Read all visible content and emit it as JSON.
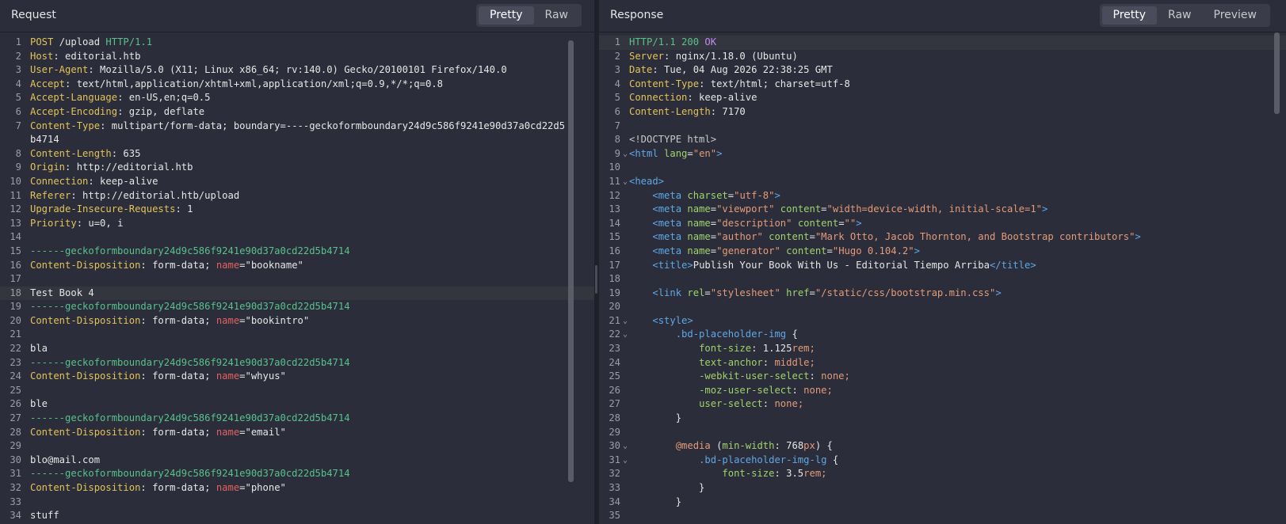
{
  "request": {
    "title": "Request",
    "tabs": [
      "Pretty",
      "Raw"
    ],
    "active_tab": "Pretty",
    "lines": [
      {
        "n": "1",
        "segs": [
          [
            "m",
            "POST"
          ],
          [
            "str",
            " /upload "
          ],
          [
            "v",
            "HTTP/1.1"
          ]
        ]
      },
      {
        "n": "2",
        "segs": [
          [
            "k",
            "Host"
          ],
          [
            "str",
            ": editorial.htb"
          ]
        ]
      },
      {
        "n": "3",
        "segs": [
          [
            "k",
            "User-Agent"
          ],
          [
            "str",
            ": Mozilla/5.0 (X11; Linux x86_64; rv:140.0) Gecko/20100101 Firefox/140.0"
          ]
        ]
      },
      {
        "n": "4",
        "segs": [
          [
            "k",
            "Accept"
          ],
          [
            "str",
            ": text/html,application/xhtml+xml,application/xml;q=0.9,*/*;q=0.8"
          ]
        ]
      },
      {
        "n": "5",
        "segs": [
          [
            "k",
            "Accept-Language"
          ],
          [
            "str",
            ": en-US,en;q=0.5"
          ]
        ]
      },
      {
        "n": "6",
        "segs": [
          [
            "k",
            "Accept-Encoding"
          ],
          [
            "str",
            ": gzip, deflate"
          ]
        ]
      },
      {
        "n": "7",
        "segs": [
          [
            "k",
            "Content-Type"
          ],
          [
            "str",
            ": multipart/form-data; boundary=----geckoformboundary24d9c586f9241e90d37a0cd22d5"
          ]
        ]
      },
      {
        "n": "",
        "segs": [
          [
            "str",
            "b4714"
          ]
        ]
      },
      {
        "n": "8",
        "segs": [
          [
            "k",
            "Content-Length"
          ],
          [
            "str",
            ": 635"
          ]
        ]
      },
      {
        "n": "9",
        "segs": [
          [
            "k",
            "Origin"
          ],
          [
            "str",
            ": http://editorial.htb"
          ]
        ]
      },
      {
        "n": "10",
        "segs": [
          [
            "k",
            "Connection"
          ],
          [
            "str",
            ": keep-alive"
          ]
        ]
      },
      {
        "n": "11",
        "segs": [
          [
            "k",
            "Referer"
          ],
          [
            "str",
            ": http://editorial.htb/upload"
          ]
        ]
      },
      {
        "n": "12",
        "segs": [
          [
            "k",
            "Upgrade-Insecure-Requests"
          ],
          [
            "str",
            ": 1"
          ]
        ]
      },
      {
        "n": "13",
        "segs": [
          [
            "k",
            "Priority"
          ],
          [
            "str",
            ": u=0, i"
          ]
        ]
      },
      {
        "n": "14",
        "segs": []
      },
      {
        "n": "15",
        "segs": [
          [
            "b",
            "------geckoformboundary24d9c586f9241e90d37a0cd22d5b4714"
          ]
        ]
      },
      {
        "n": "16",
        "segs": [
          [
            "k",
            "Content-Disposition"
          ],
          [
            "str",
            ": form-data; "
          ],
          [
            "nm",
            "name"
          ],
          [
            "str",
            "=\"bookname\""
          ]
        ]
      },
      {
        "n": "17",
        "segs": []
      },
      {
        "n": "18",
        "segs": [
          [
            "str",
            "Test Book 4"
          ]
        ],
        "hl": true
      },
      {
        "n": "19",
        "segs": [
          [
            "b",
            "------geckoformboundary24d9c586f9241e90d37a0cd22d5b4714"
          ]
        ]
      },
      {
        "n": "20",
        "segs": [
          [
            "k",
            "Content-Disposition"
          ],
          [
            "str",
            ": form-data; "
          ],
          [
            "nm",
            "name"
          ],
          [
            "str",
            "=\"bookintro\""
          ]
        ]
      },
      {
        "n": "21",
        "segs": []
      },
      {
        "n": "22",
        "segs": [
          [
            "str",
            "bla"
          ]
        ]
      },
      {
        "n": "23",
        "segs": [
          [
            "b",
            "------geckoformboundary24d9c586f9241e90d37a0cd22d5b4714"
          ]
        ]
      },
      {
        "n": "24",
        "segs": [
          [
            "k",
            "Content-Disposition"
          ],
          [
            "str",
            ": form-data; "
          ],
          [
            "nm",
            "name"
          ],
          [
            "str",
            "=\"whyus\""
          ]
        ]
      },
      {
        "n": "25",
        "segs": []
      },
      {
        "n": "26",
        "segs": [
          [
            "str",
            "ble"
          ]
        ]
      },
      {
        "n": "27",
        "segs": [
          [
            "b",
            "------geckoformboundary24d9c586f9241e90d37a0cd22d5b4714"
          ]
        ]
      },
      {
        "n": "28",
        "segs": [
          [
            "k",
            "Content-Disposition"
          ],
          [
            "str",
            ": form-data; "
          ],
          [
            "nm",
            "name"
          ],
          [
            "str",
            "=\"email\""
          ]
        ]
      },
      {
        "n": "29",
        "segs": []
      },
      {
        "n": "30",
        "segs": [
          [
            "str",
            "blo@mail.com"
          ]
        ]
      },
      {
        "n": "31",
        "segs": [
          [
            "b",
            "------geckoformboundary24d9c586f9241e90d37a0cd22d5b4714"
          ]
        ]
      },
      {
        "n": "32",
        "segs": [
          [
            "k",
            "Content-Disposition"
          ],
          [
            "str",
            ": form-data; "
          ],
          [
            "nm",
            "name"
          ],
          [
            "str",
            "=\"phone\""
          ]
        ]
      },
      {
        "n": "33",
        "segs": []
      },
      {
        "n": "34",
        "segs": [
          [
            "str",
            "stuff"
          ]
        ]
      }
    ]
  },
  "response": {
    "title": "Response",
    "tabs": [
      "Pretty",
      "Raw",
      "Preview"
    ],
    "active_tab": "Pretty",
    "lines": [
      {
        "n": "1",
        "segs": [
          [
            "v",
            "HTTP/1.1 200 "
          ],
          [
            "purp",
            "OK"
          ]
        ],
        "hl": true
      },
      {
        "n": "2",
        "segs": [
          [
            "k",
            "Server"
          ],
          [
            "str",
            ": nginx/1.18.0 (Ubuntu)"
          ]
        ]
      },
      {
        "n": "3",
        "segs": [
          [
            "k",
            "Date"
          ],
          [
            "str",
            ": Tue, 04 Aug 2026 22:38:25 GMT"
          ]
        ]
      },
      {
        "n": "4",
        "segs": [
          [
            "k",
            "Content-Type"
          ],
          [
            "str",
            ": text/html; charset=utf-8"
          ]
        ]
      },
      {
        "n": "5",
        "segs": [
          [
            "k",
            "Connection"
          ],
          [
            "str",
            ": keep-alive"
          ]
        ]
      },
      {
        "n": "6",
        "segs": [
          [
            "k",
            "Content-Length"
          ],
          [
            "str",
            ": 7170"
          ]
        ]
      },
      {
        "n": "7",
        "segs": []
      },
      {
        "n": "8",
        "segs": [
          [
            "dt",
            "<!DOCTYPE html>"
          ]
        ]
      },
      {
        "n": "9",
        "fold": true,
        "segs": [
          [
            "tag",
            "<html "
          ],
          [
            "attr",
            "lang"
          ],
          [
            "str",
            "="
          ],
          [
            "aval",
            "\"en\""
          ],
          [
            "tag",
            ">"
          ]
        ]
      },
      {
        "n": "10",
        "segs": []
      },
      {
        "n": "11",
        "fold": true,
        "segs": [
          [
            "tag",
            "<head>"
          ]
        ]
      },
      {
        "n": "12",
        "segs": [
          [
            "str",
            "    "
          ],
          [
            "tag",
            "<meta "
          ],
          [
            "attr",
            "charset"
          ],
          [
            "str",
            "="
          ],
          [
            "aval",
            "\"utf-8\""
          ],
          [
            "tag",
            ">"
          ]
        ]
      },
      {
        "n": "13",
        "segs": [
          [
            "str",
            "    "
          ],
          [
            "tag",
            "<meta "
          ],
          [
            "attr",
            "name"
          ],
          [
            "str",
            "="
          ],
          [
            "aval",
            "\"viewport\""
          ],
          [
            "attr",
            " content"
          ],
          [
            "str",
            "="
          ],
          [
            "aval",
            "\"width=device-width, initial-scale=1\""
          ],
          [
            "tag",
            ">"
          ]
        ]
      },
      {
        "n": "14",
        "segs": [
          [
            "str",
            "    "
          ],
          [
            "tag",
            "<meta "
          ],
          [
            "attr",
            "name"
          ],
          [
            "str",
            "="
          ],
          [
            "aval",
            "\"description\""
          ],
          [
            "attr",
            " content"
          ],
          [
            "str",
            "="
          ],
          [
            "aval",
            "\"\""
          ],
          [
            "tag",
            ">"
          ]
        ]
      },
      {
        "n": "15",
        "segs": [
          [
            "str",
            "    "
          ],
          [
            "tag",
            "<meta "
          ],
          [
            "attr",
            "name"
          ],
          [
            "str",
            "="
          ],
          [
            "aval",
            "\"author\""
          ],
          [
            "attr",
            " content"
          ],
          [
            "str",
            "="
          ],
          [
            "aval",
            "\"Mark Otto, Jacob Thornton, and Bootstrap contributors\""
          ],
          [
            "tag",
            ">"
          ]
        ]
      },
      {
        "n": "16",
        "segs": [
          [
            "str",
            "    "
          ],
          [
            "tag",
            "<meta "
          ],
          [
            "attr",
            "name"
          ],
          [
            "str",
            "="
          ],
          [
            "aval",
            "\"generator\""
          ],
          [
            "attr",
            " content"
          ],
          [
            "str",
            "="
          ],
          [
            "aval",
            "\"Hugo 0.104.2\""
          ],
          [
            "tag",
            ">"
          ]
        ]
      },
      {
        "n": "17",
        "segs": [
          [
            "str",
            "    "
          ],
          [
            "tag",
            "<title>"
          ],
          [
            "str",
            "Publish Your Book With Us - Editorial Tiempo Arriba"
          ],
          [
            "tag",
            "</title>"
          ]
        ]
      },
      {
        "n": "18",
        "segs": []
      },
      {
        "n": "19",
        "segs": [
          [
            "str",
            "    "
          ],
          [
            "tag",
            "<link "
          ],
          [
            "attr",
            "rel"
          ],
          [
            "str",
            "="
          ],
          [
            "aval",
            "\"stylesheet\""
          ],
          [
            "attr",
            " href"
          ],
          [
            "str",
            "="
          ],
          [
            "aval",
            "\"/static/css/bootstrap.min.css\""
          ],
          [
            "tag",
            ">"
          ]
        ]
      },
      {
        "n": "20",
        "segs": []
      },
      {
        "n": "21",
        "fold": true,
        "segs": [
          [
            "str",
            "    "
          ],
          [
            "tag",
            "<style>"
          ]
        ]
      },
      {
        "n": "22",
        "fold": true,
        "segs": [
          [
            "str",
            "        "
          ],
          [
            "sel",
            ".bd-placeholder-img"
          ],
          [
            "str",
            " {"
          ]
        ]
      },
      {
        "n": "23",
        "segs": [
          [
            "str",
            "            "
          ],
          [
            "prop",
            "font-size"
          ],
          [
            "str",
            ": "
          ],
          [
            "str",
            "1.125"
          ],
          [
            "num",
            "rem;"
          ]
        ]
      },
      {
        "n": "24",
        "segs": [
          [
            "str",
            "            "
          ],
          [
            "prop",
            "text-anchor"
          ],
          [
            "str",
            ": "
          ],
          [
            "num",
            "middle;"
          ]
        ]
      },
      {
        "n": "25",
        "segs": [
          [
            "str",
            "            "
          ],
          [
            "prop",
            "-webkit-user-select"
          ],
          [
            "str",
            ": "
          ],
          [
            "num",
            "none;"
          ]
        ]
      },
      {
        "n": "26",
        "segs": [
          [
            "str",
            "            "
          ],
          [
            "prop",
            "-moz-user-select"
          ],
          [
            "str",
            ": "
          ],
          [
            "num",
            "none;"
          ]
        ]
      },
      {
        "n": "27",
        "segs": [
          [
            "str",
            "            "
          ],
          [
            "prop",
            "user-select"
          ],
          [
            "str",
            ": "
          ],
          [
            "num",
            "none;"
          ]
        ]
      },
      {
        "n": "28",
        "segs": [
          [
            "str",
            "        }"
          ]
        ]
      },
      {
        "n": "29",
        "segs": []
      },
      {
        "n": "30",
        "fold": true,
        "segs": [
          [
            "str",
            "        "
          ],
          [
            "kw",
            "@media"
          ],
          [
            "str",
            " ("
          ],
          [
            "prop",
            "min-width"
          ],
          [
            "str",
            ": 768"
          ],
          [
            "num",
            "px"
          ],
          [
            "str",
            ") {"
          ]
        ]
      },
      {
        "n": "31",
        "fold": true,
        "segs": [
          [
            "str",
            "            "
          ],
          [
            "sel",
            ".bd-placeholder-img-lg"
          ],
          [
            "str",
            " {"
          ]
        ]
      },
      {
        "n": "32",
        "segs": [
          [
            "str",
            "                "
          ],
          [
            "prop",
            "font-size"
          ],
          [
            "str",
            ": 3.5"
          ],
          [
            "num",
            "rem;"
          ]
        ]
      },
      {
        "n": "33",
        "segs": [
          [
            "str",
            "            }"
          ]
        ]
      },
      {
        "n": "34",
        "segs": [
          [
            "str",
            "        }"
          ]
        ]
      },
      {
        "n": "35",
        "segs": []
      }
    ]
  }
}
